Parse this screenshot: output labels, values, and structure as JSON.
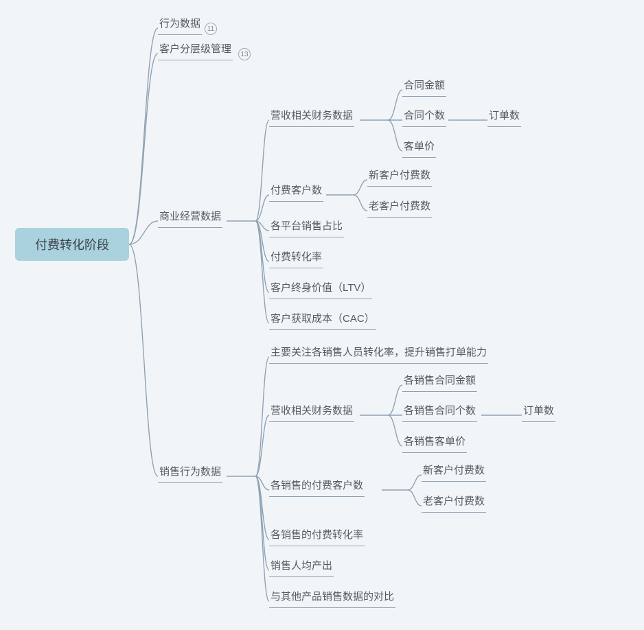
{
  "root": {
    "label": "付费转化阶段"
  },
  "level1": {
    "n0": {
      "label": "行为数据",
      "badge": "11"
    },
    "n1": {
      "label": "客户分层级管理",
      "badge": "13"
    },
    "n2": {
      "label": "商业经营数据"
    },
    "n3": {
      "label": "销售行为数据"
    }
  },
  "biz": {
    "fin": {
      "label": "营收相关财务数据"
    },
    "fin_children": {
      "c0": {
        "label": "合同金额"
      },
      "c1": {
        "label": "合同个数"
      },
      "c1_side": {
        "label": "订单数"
      },
      "c2": {
        "label": "客单价"
      }
    },
    "pay": {
      "label": "付费客户数"
    },
    "pay_children": {
      "c0": {
        "label": "新客户付费数"
      },
      "c1": {
        "label": "老客户付费数"
      }
    },
    "platform": {
      "label": "各平台销售占比"
    },
    "rate": {
      "label": "付费转化率"
    },
    "ltv": {
      "label": "客户终身价值（LTV）"
    },
    "cac": {
      "label": "客户获取成本（CAC）"
    }
  },
  "sales": {
    "focus": {
      "label": "主要关注各销售人员转化率，提升销售打单能力"
    },
    "fin": {
      "label": "营收相关财务数据"
    },
    "fin_children": {
      "c0": {
        "label": "各销售合同金额"
      },
      "c1": {
        "label": "各销售合同个数"
      },
      "c1_side": {
        "label": "订单数"
      },
      "c2": {
        "label": "各销售客单价"
      }
    },
    "pay": {
      "label": "各销售的付费客户数"
    },
    "pay_children": {
      "c0": {
        "label": "新客户付费数"
      },
      "c1": {
        "label": "老客户付费数"
      }
    },
    "rate": {
      "label": "各销售的付费转化率"
    },
    "avg": {
      "label": "销售人均产出"
    },
    "compare": {
      "label": "与其他产品销售数据的对比"
    }
  }
}
